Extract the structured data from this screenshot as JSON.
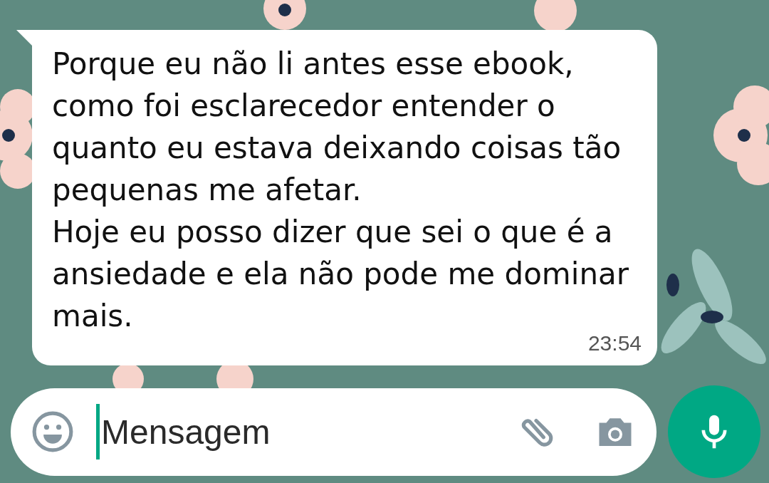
{
  "message": {
    "text": "Porque eu não li antes esse ebook, como foi esclarecedor entender o quanto eu estava deixando coisas tão pequenas me afetar.\nHoje eu posso dizer que sei o que é a ansiedade e ela não pode me dominar mais.",
    "time": "23:54"
  },
  "composer": {
    "placeholder": "Mensagem"
  }
}
